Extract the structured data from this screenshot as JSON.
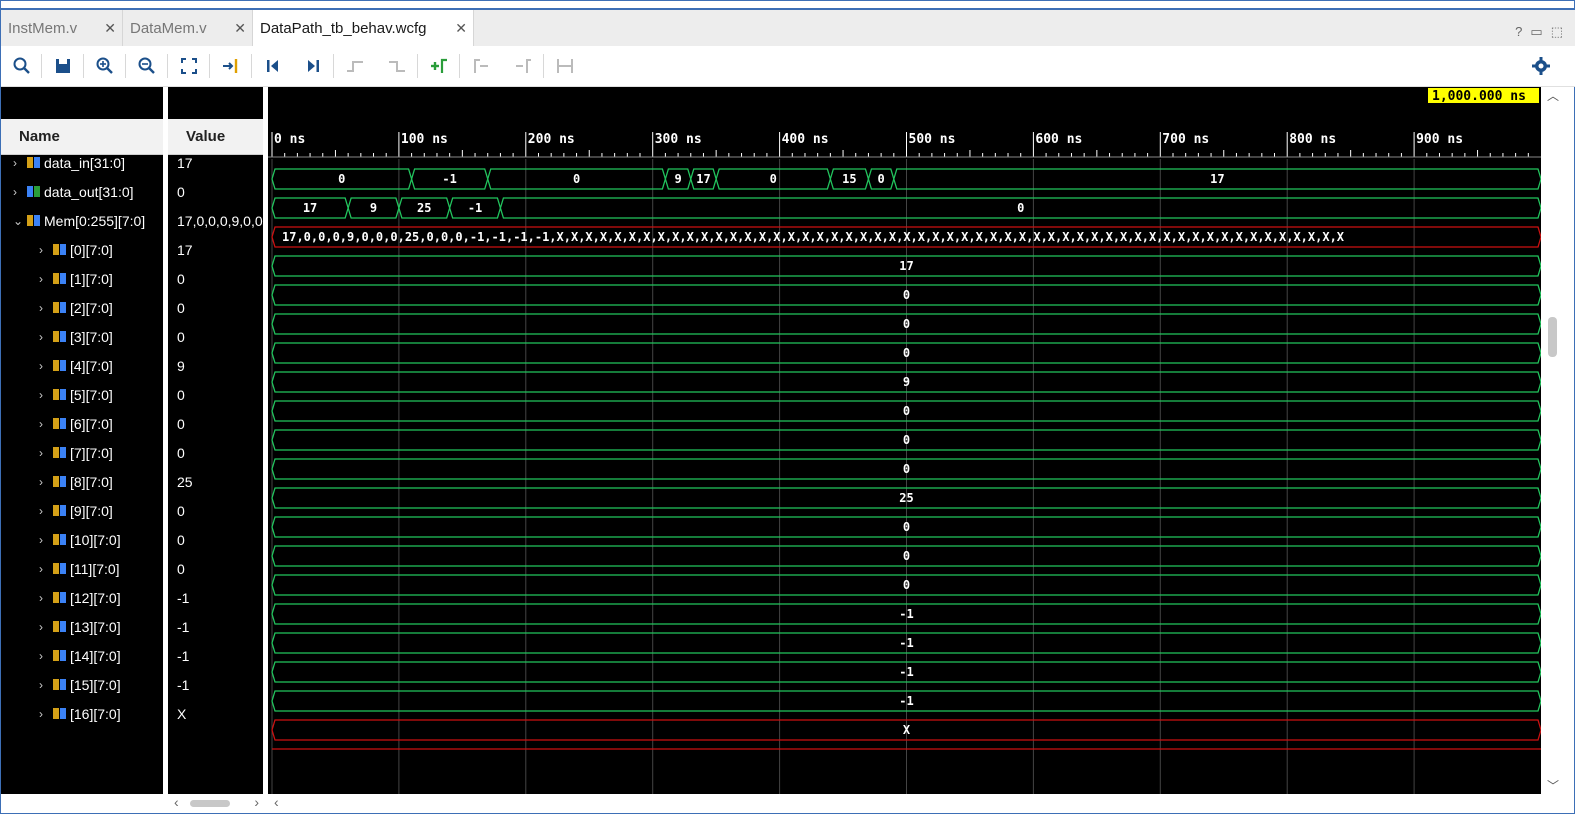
{
  "tabs": [
    {
      "label": "InstMem.v",
      "active": false
    },
    {
      "label": "DataMem.v",
      "active": false
    },
    {
      "label": "DataPath_tb_behav.wcfg",
      "active": true
    }
  ],
  "window_icons": [
    "?",
    "restore-icon",
    "maximize-icon"
  ],
  "toolbar_icons": [
    "search-icon",
    "save-icon",
    "zoom-in-icon",
    "zoom-out-icon",
    "zoom-fit-icon",
    "goto-cursor-icon",
    "go-to-time-0-icon",
    "go-to-last-time-icon",
    "previous-transition-icon",
    "next-transition-icon",
    "add-marker-icon",
    "previous-marker-icon",
    "next-marker-icon",
    "swap-cursors-icon",
    "settings-icon"
  ],
  "columns": {
    "name": "Name",
    "value": "Value"
  },
  "cursor_time": "1,000.000 ns",
  "timeline": {
    "ticks": [
      "0 ns",
      "100 ns",
      "200 ns",
      "300 ns",
      "400 ns",
      "500 ns",
      "600 ns",
      "700 ns",
      "800 ns",
      "900 ns"
    ],
    "range_ns": [
      0,
      1000
    ]
  },
  "signals": [
    {
      "name": "data_in[31:0]",
      "value": "17",
      "indent": 0,
      "expanded": false,
      "kind": "in"
    },
    {
      "name": "data_out[31:0]",
      "value": "0",
      "indent": 0,
      "expanded": false,
      "kind": "out"
    },
    {
      "name": "Mem[0:255][7:0]",
      "value": "17,0,0,0,9,0,0,0,25,0,0,0,-1,-1,-1,-1,X",
      "indent": 0,
      "expanded": true,
      "kind": "mem"
    },
    {
      "name": "[0][7:0]",
      "value": "17",
      "indent": 1,
      "expanded": false,
      "kind": "mem"
    },
    {
      "name": "[1][7:0]",
      "value": "0",
      "indent": 1,
      "expanded": false,
      "kind": "mem"
    },
    {
      "name": "[2][7:0]",
      "value": "0",
      "indent": 1,
      "expanded": false,
      "kind": "mem"
    },
    {
      "name": "[3][7:0]",
      "value": "0",
      "indent": 1,
      "expanded": false,
      "kind": "mem"
    },
    {
      "name": "[4][7:0]",
      "value": "9",
      "indent": 1,
      "expanded": false,
      "kind": "mem"
    },
    {
      "name": "[5][7:0]",
      "value": "0",
      "indent": 1,
      "expanded": false,
      "kind": "mem"
    },
    {
      "name": "[6][7:0]",
      "value": "0",
      "indent": 1,
      "expanded": false,
      "kind": "mem"
    },
    {
      "name": "[7][7:0]",
      "value": "0",
      "indent": 1,
      "expanded": false,
      "kind": "mem"
    },
    {
      "name": "[8][7:0]",
      "value": "25",
      "indent": 1,
      "expanded": false,
      "kind": "mem"
    },
    {
      "name": "[9][7:0]",
      "value": "0",
      "indent": 1,
      "expanded": false,
      "kind": "mem"
    },
    {
      "name": "[10][7:0]",
      "value": "0",
      "indent": 1,
      "expanded": false,
      "kind": "mem"
    },
    {
      "name": "[11][7:0]",
      "value": "0",
      "indent": 1,
      "expanded": false,
      "kind": "mem"
    },
    {
      "name": "[12][7:0]",
      "value": "-1",
      "indent": 1,
      "expanded": false,
      "kind": "mem"
    },
    {
      "name": "[13][7:0]",
      "value": "-1",
      "indent": 1,
      "expanded": false,
      "kind": "mem"
    },
    {
      "name": "[14][7:0]",
      "value": "-1",
      "indent": 1,
      "expanded": false,
      "kind": "mem"
    },
    {
      "name": "[15][7:0]",
      "value": "-1",
      "indent": 1,
      "expanded": false,
      "kind": "mem"
    },
    {
      "name": "[16][7:0]",
      "value": "X",
      "indent": 1,
      "expanded": false,
      "kind": "mem"
    }
  ],
  "waveforms": [
    {
      "segments": [
        [
          0,
          110,
          "0"
        ],
        [
          110,
          170,
          "-1"
        ],
        [
          170,
          310,
          "0"
        ],
        [
          310,
          330,
          "9"
        ],
        [
          330,
          350,
          "17"
        ],
        [
          350,
          440,
          "0"
        ],
        [
          440,
          470,
          "15"
        ],
        [
          470,
          490,
          "0"
        ],
        [
          490,
          1000,
          "17"
        ]
      ],
      "x": false
    },
    {
      "segments": [
        [
          0,
          60,
          "17"
        ],
        [
          60,
          100,
          "9"
        ],
        [
          100,
          140,
          "25"
        ],
        [
          140,
          180,
          "-1"
        ],
        [
          180,
          1000,
          "0"
        ]
      ],
      "x": false
    },
    {
      "segments": [
        [
          0,
          1000,
          "17,0,0,0,9,0,0,0,25,0,0,0,-1,-1,-1,-1,X,X,X,X,X,X,X,X,X,X,X,X,X,X,X,X,X,X,X,X,X,X,X,X,X,X,X,X,X,X,X,X,X,X,X,X,X,X,X,X,X,X,X,X,X,X,X,X,X,X,X,X,X,X,X"
        ]
      ],
      "x": true,
      "left_label": true
    },
    {
      "segments": [
        [
          0,
          1000,
          "17"
        ]
      ],
      "x": false
    },
    {
      "segments": [
        [
          0,
          1000,
          "0"
        ]
      ],
      "x": false
    },
    {
      "segments": [
        [
          0,
          1000,
          "0"
        ]
      ],
      "x": false
    },
    {
      "segments": [
        [
          0,
          1000,
          "0"
        ]
      ],
      "x": false
    },
    {
      "segments": [
        [
          0,
          1000,
          "9"
        ]
      ],
      "x": false
    },
    {
      "segments": [
        [
          0,
          1000,
          "0"
        ]
      ],
      "x": false
    },
    {
      "segments": [
        [
          0,
          1000,
          "0"
        ]
      ],
      "x": false
    },
    {
      "segments": [
        [
          0,
          1000,
          "0"
        ]
      ],
      "x": false
    },
    {
      "segments": [
        [
          0,
          1000,
          "25"
        ]
      ],
      "x": false
    },
    {
      "segments": [
        [
          0,
          1000,
          "0"
        ]
      ],
      "x": false
    },
    {
      "segments": [
        [
          0,
          1000,
          "0"
        ]
      ],
      "x": false
    },
    {
      "segments": [
        [
          0,
          1000,
          "0"
        ]
      ],
      "x": false
    },
    {
      "segments": [
        [
          0,
          1000,
          "-1"
        ]
      ],
      "x": false
    },
    {
      "segments": [
        [
          0,
          1000,
          "-1"
        ]
      ],
      "x": false
    },
    {
      "segments": [
        [
          0,
          1000,
          "-1"
        ]
      ],
      "x": false
    },
    {
      "segments": [
        [
          0,
          1000,
          "-1"
        ]
      ],
      "x": false
    },
    {
      "segments": [
        [
          0,
          1000,
          "X"
        ]
      ],
      "x": true
    }
  ],
  "colors": {
    "wave_ok": "#22c55e",
    "wave_x": "#cc1111",
    "cursor_bg": "#ffff00",
    "frame": "#3d6fb6"
  }
}
